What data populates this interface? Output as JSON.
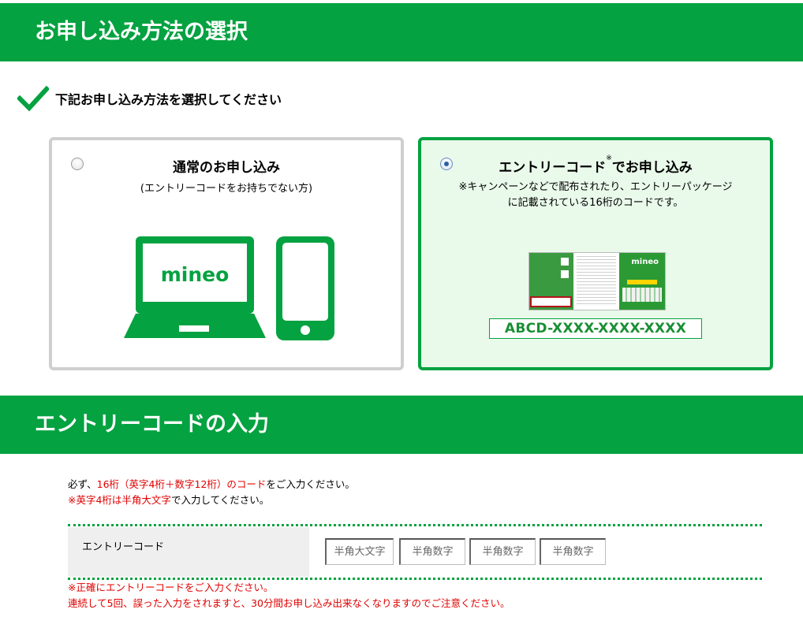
{
  "header_method": {
    "title": "お申し込み方法の選択"
  },
  "instruction": {
    "text": "下記お申し込み方法を選択してください",
    "icon": "checkmark-icon"
  },
  "options": {
    "normal": {
      "title": "通常のお申し込み",
      "subtitle": "(エントリーコードをお持ちでない方)",
      "selected": false,
      "illustration_logo": "mineo"
    },
    "entry": {
      "title_before": "エントリーコード",
      "title_sup": "※",
      "title_after": "でお申し込み",
      "note_line1": "※キャンペーンなどで配布されたり、エントリーパッケージ",
      "note_line2": "に記載されている16桁のコードです。",
      "selected": true,
      "package_logo": "mineo",
      "code_sample": "ABCD-XXXX-XXXX-XXXX"
    }
  },
  "header_entry": {
    "title": "エントリーコードの入力"
  },
  "notes": {
    "line1_a": "必ず、",
    "line1_red": "16桁（英字4桁＋数字12桁）のコード",
    "line1_b": "をご入力ください。",
    "line2_red": "※英字4桁は半角大文字",
    "line2_b": "で入力してください。"
  },
  "form": {
    "label": "エントリーコード",
    "fields": [
      {
        "placeholder": "半角大文字",
        "value": ""
      },
      {
        "placeholder": "半角数字",
        "value": ""
      },
      {
        "placeholder": "半角数字",
        "value": ""
      },
      {
        "placeholder": "半角数字",
        "value": ""
      }
    ]
  },
  "warnings": {
    "line1": "※正確にエントリーコードをご入力ください。",
    "line2": "連続して5回、誤った入力をされますと、30分間お申し込み出来なくなりますのでご注意ください。"
  },
  "colors": {
    "brand_green": "#04a240",
    "warning_red": "#e00000",
    "selected_bg": "#e9f9ea",
    "code_text": "#1a8f34"
  }
}
